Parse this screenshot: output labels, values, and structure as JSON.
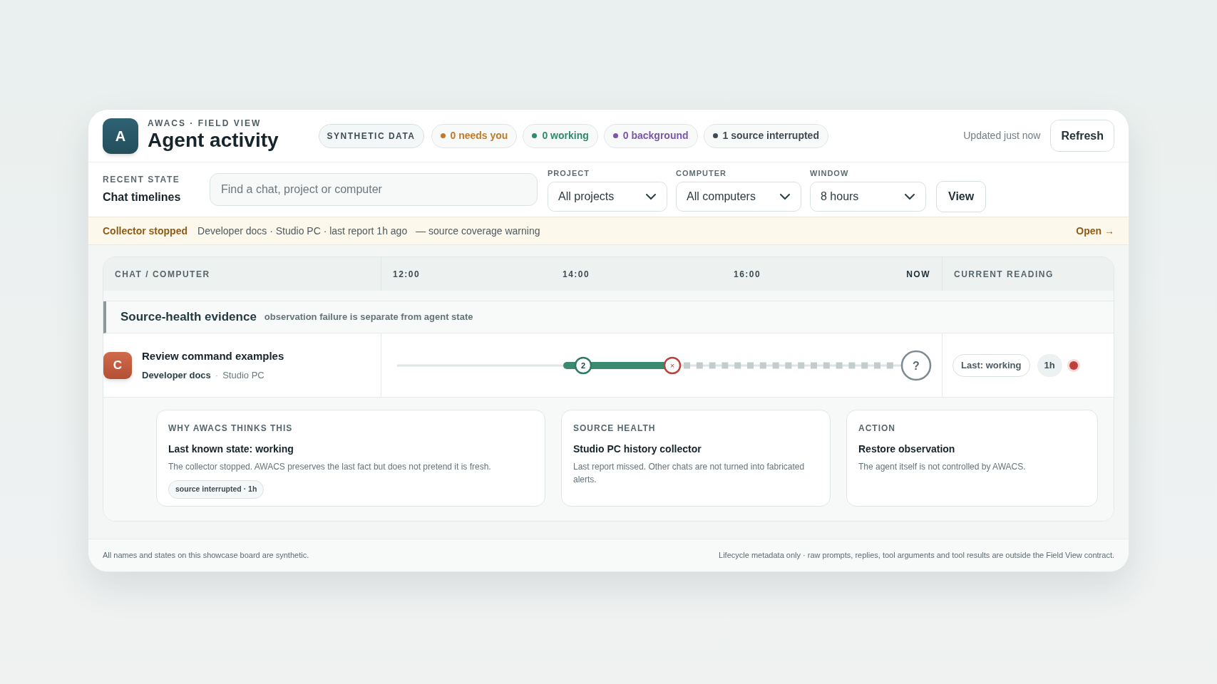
{
  "brand": {
    "logo": "A",
    "eyebrow": "AWACS · FIELD VIEW",
    "title": "Agent activity"
  },
  "badge": "SYNTHETIC DATA",
  "pills": [
    {
      "label": "0 needs you",
      "color": "#c07a2a"
    },
    {
      "label": "0 working",
      "color": "#2f8a6a"
    },
    {
      "label": "0 background",
      "color": "#7a55a8"
    },
    {
      "label": "1 source interrupted",
      "color": "#3f4a52"
    }
  ],
  "updated": "Updated just now",
  "refresh": "Refresh",
  "recent": {
    "eyebrow": "RECENT STATE",
    "title": "Chat timelines"
  },
  "search": {
    "placeholder": "Find a chat, project or computer"
  },
  "filters": [
    {
      "label": "PROJECT",
      "value": "All projects"
    },
    {
      "label": "COMPUTER",
      "value": "All computers"
    },
    {
      "label": "WINDOW",
      "value": "8 hours"
    }
  ],
  "view_button": "View",
  "alert": {
    "title": "Collector stopped",
    "detail": "Developer docs · Studio PC · last report 1h ago",
    "note": "— source coverage warning",
    "link": "Open →"
  },
  "table": {
    "columns": [
      "CHAT / COMPUTER",
      "12:00",
      "14:00",
      "16:00",
      "NOW",
      "CURRENT READING"
    ],
    "group": {
      "title": "Source-health evidence",
      "note": "observation failure is separate from agent state"
    },
    "rows": [
      {
        "avatar": "C",
        "title": "Review command examples",
        "project": "Developer docs",
        "separator": "·",
        "computer": "Studio PC",
        "markers": [
          {
            "kind": "count",
            "label": "2"
          },
          {
            "kind": "stop",
            "label": "×"
          },
          {
            "kind": "unknown",
            "label": "?"
          }
        ],
        "reading": "Last: working",
        "age": "1h",
        "color": "#c0403a"
      }
    ]
  },
  "details": [
    {
      "eyebrow": "WHY AWACS THINKS THIS",
      "title": "Last known state: working",
      "text": "The collector stopped. AWACS preserves the last fact but does not pretend it is fresh.",
      "tag": "source interrupted · 1h"
    },
    {
      "eyebrow": "SOURCE HEALTH",
      "title": "Studio PC history collector",
      "text": "Last report missed. Other chats are not turned into fabricated alerts."
    },
    {
      "eyebrow": "ACTION",
      "title": "Restore observation",
      "text": "The agent itself is not controlled by AWACS."
    }
  ],
  "footer": {
    "left": "All names and states on this showcase board are synthetic.",
    "right": "Lifecycle metadata only · raw prompts, replies, tool arguments and tool results are outside the Field View contract."
  }
}
